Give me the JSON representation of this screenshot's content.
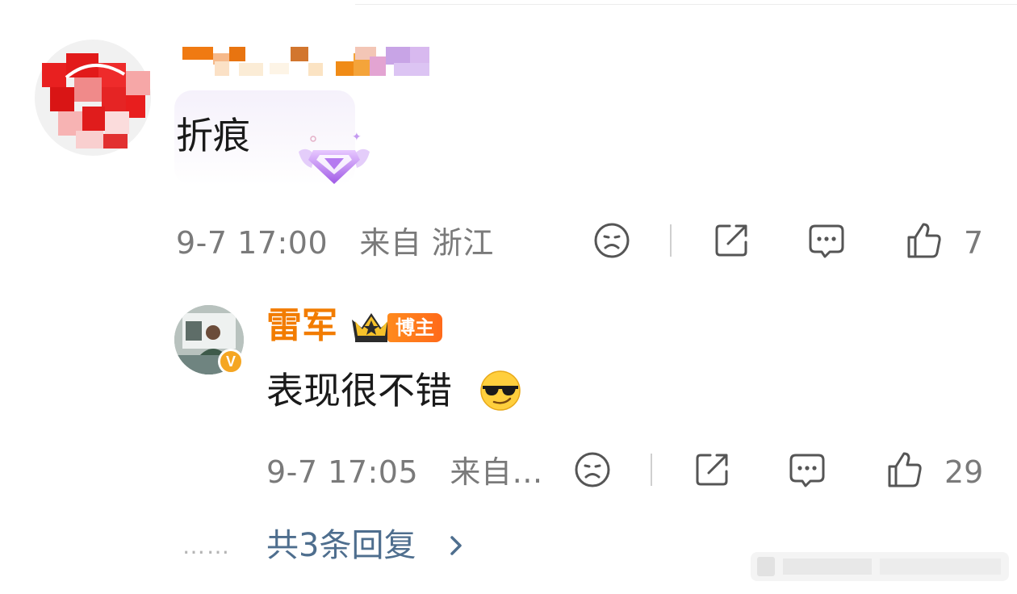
{
  "comment": {
    "text": "折痕",
    "time": "9-7 17:00",
    "location": "来自 浙江",
    "likes": "7"
  },
  "reply": {
    "username": "雷军",
    "tag": "博主",
    "text": "表现很不错",
    "time": "9-7 17:05",
    "location": "来自…",
    "likes": "29"
  },
  "more_replies": "共3条回复",
  "dots": "……",
  "icons": {
    "dislike": "sad-face-icon",
    "share": "share-icon",
    "comment": "comment-icon",
    "like": "thumbs-up-icon",
    "crown": "crown-icon",
    "emoji": "sunglasses-emoji-icon",
    "gem": "diamond-badge-icon",
    "chevron": "chevron-right-icon"
  },
  "colors": {
    "name_orange": "#f27c00",
    "meta_gray": "#7a7a7a",
    "link_blue": "#4e6e8e",
    "tag_orange": "#ff6a1a"
  }
}
